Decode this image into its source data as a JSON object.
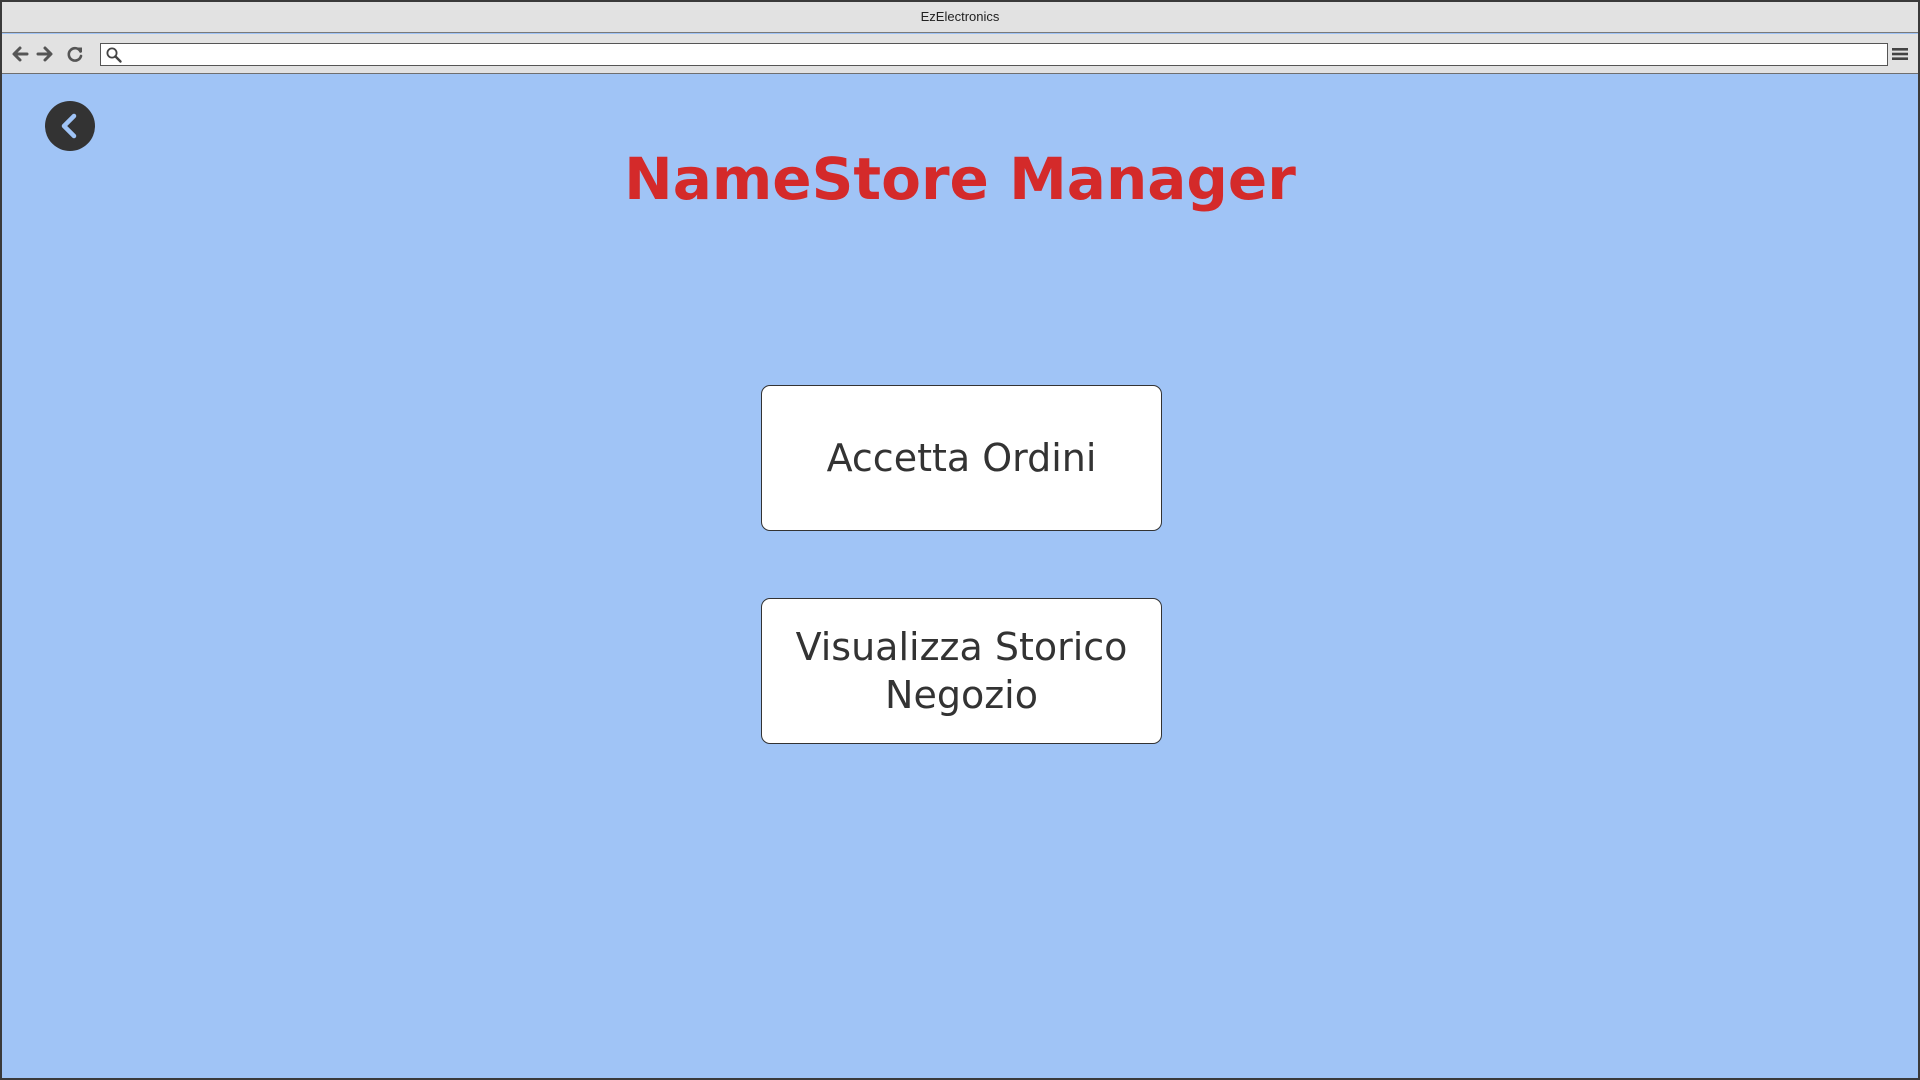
{
  "window": {
    "title": "EzElectronics"
  },
  "toolbar": {
    "back_icon": "arrow-left-icon",
    "forward_icon": "arrow-right-icon",
    "reload_icon": "reload-icon",
    "search_icon": "search-icon",
    "menu_icon": "hamburger-menu-icon",
    "address_value": ""
  },
  "page": {
    "back_icon": "chevron-left-icon",
    "title": "NameStore Manager",
    "buttons": [
      {
        "label": "Accetta Ordini"
      },
      {
        "label": "Visualizza Storico Negozio"
      }
    ]
  },
  "colors": {
    "background": "#a0c4f6",
    "title": "#d42a2a",
    "button_bg": "#ffffff",
    "button_text": "#333333",
    "back_button_bg": "#333333",
    "back_chevron": "#a0c4f6",
    "chrome": "#e2e2e2"
  }
}
